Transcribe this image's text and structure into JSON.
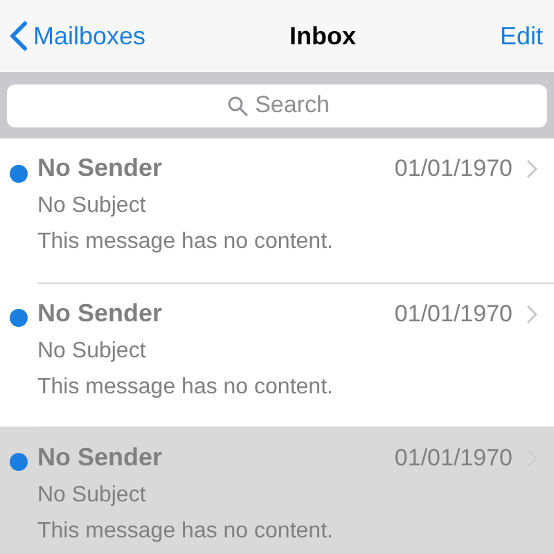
{
  "nav": {
    "back": "Mailboxes",
    "title": "Inbox",
    "action": "Edit"
  },
  "search": {
    "placeholder": "Search"
  },
  "messages": [
    {
      "sender": "No Sender",
      "date": "01/01/1970",
      "subject": "No Subject",
      "preview": "This message has no content.",
      "unread": true,
      "selected": false
    },
    {
      "sender": "No Sender",
      "date": "01/01/1970",
      "subject": "No Subject",
      "preview": "This message has no content.",
      "unread": true,
      "selected": false
    },
    {
      "sender": "No Sender",
      "date": "01/01/1970",
      "subject": "No Subject",
      "preview": "This message has no content.",
      "unread": true,
      "selected": true
    }
  ]
}
